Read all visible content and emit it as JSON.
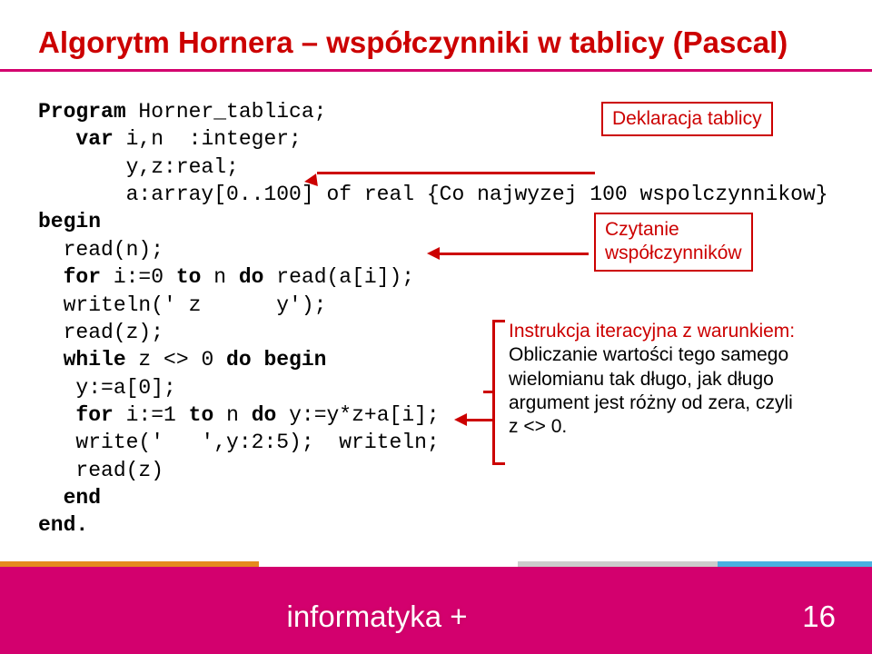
{
  "title": "Algorytm Hornera – współczynniki w tablicy (Pascal)",
  "code": {
    "l1a": "Program",
    "l1b": " Horner_tablica;",
    "l2a": "   var",
    "l2b": " i,n  :integer;",
    "l3": "       y,z:real;",
    "l4": "       a:array[0..100] of real {Co najwyzej 100 wspolczynnikow}",
    "l5": "begin",
    "l6": "  read(n);",
    "l7a": "  for",
    "l7b": " i:=0 ",
    "l7c": "to",
    "l7d": " n ",
    "l7e": "do",
    "l7f": " read(a[i]);",
    "l8": "  writeln(' z      y');",
    "l9": "  read(z);",
    "l10a": "  while",
    "l10b": " z <> 0 ",
    "l10c": "do begin",
    "l11": "   y:=a[0];",
    "l12a": "   for",
    "l12b": " i:=1 ",
    "l12c": "to",
    "l12d": " n ",
    "l12e": "do",
    "l12f": " y:=y*z+a[i];",
    "l13": "   write('   ',y:2:5);  writeln;",
    "l14": "   read(z)",
    "l15": "  end",
    "l16": "end."
  },
  "callouts": {
    "c1": "Deklaracja tablicy",
    "c2_l1": "Czytanie",
    "c2_l2": "współczynników",
    "c3_l1": "Instrukcja iteracyjna z warunkiem:",
    "c3_l2": "Obliczanie wartości tego samego",
    "c3_l3": "wielomianu tak długo, jak długo",
    "c3_l4": "argument jest różny od zera, czyli",
    "c3_l5": "z <> 0."
  },
  "footer": {
    "text": "informatyka +",
    "page": "16"
  }
}
